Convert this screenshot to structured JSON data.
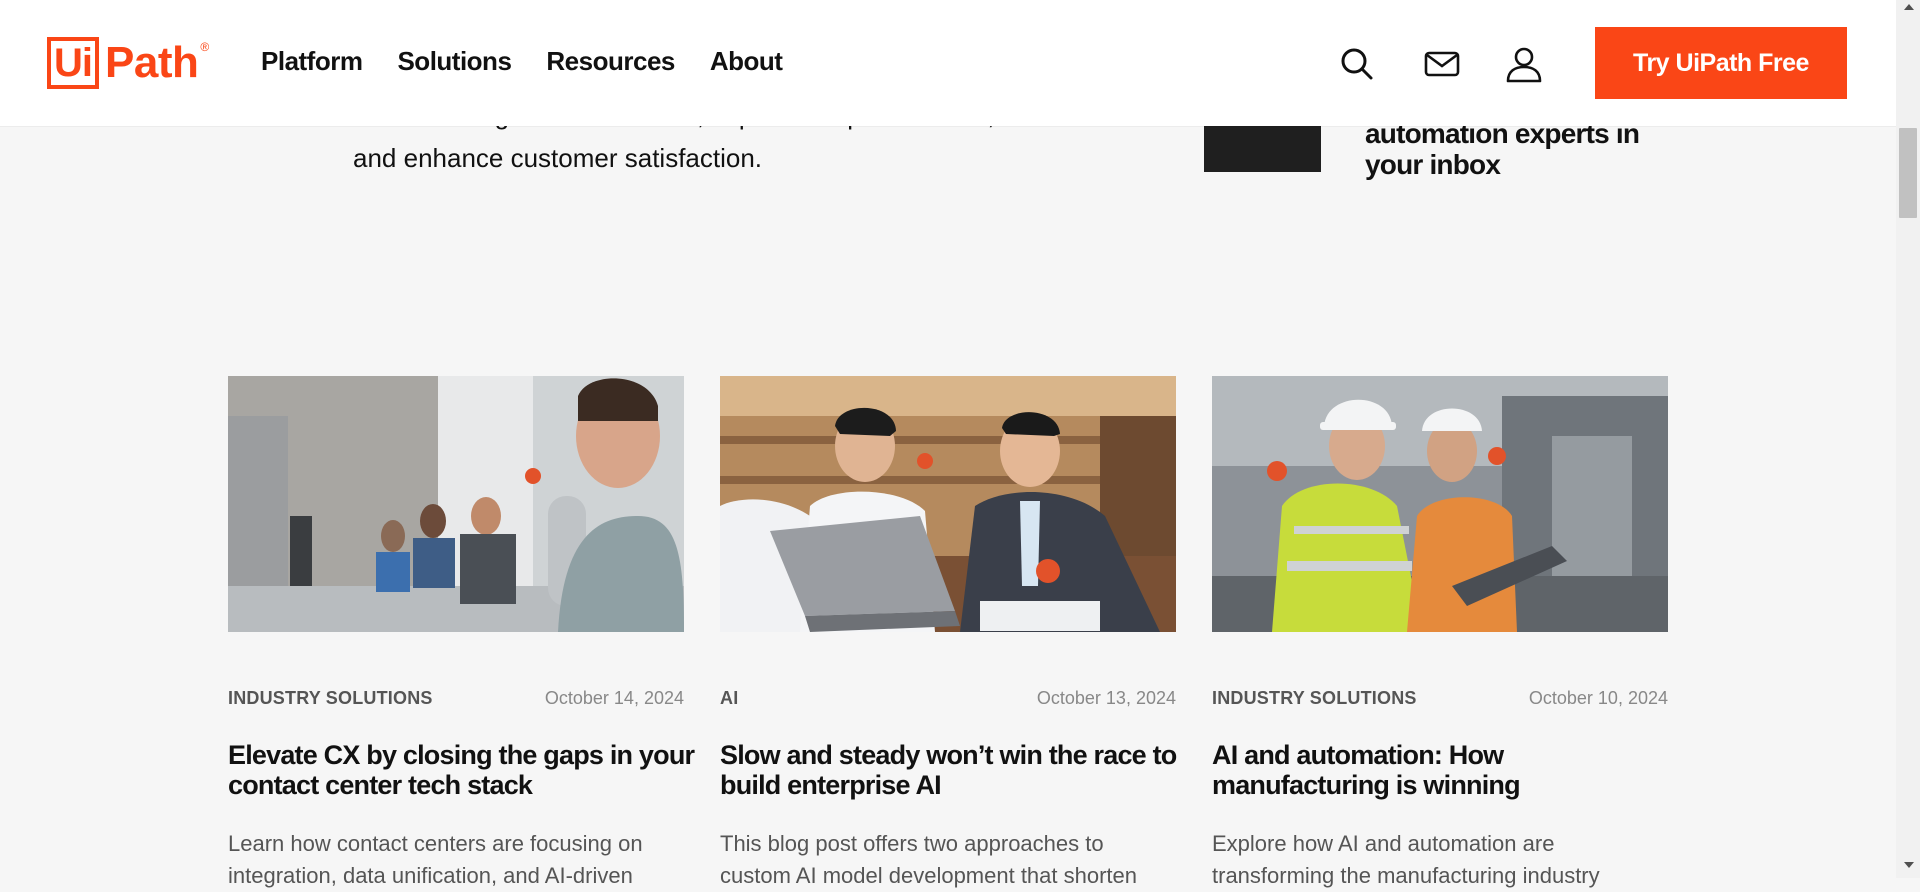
{
  "header": {
    "logo_box": "Ui",
    "logo_word": "Path",
    "logo_reg": "®",
    "nav": [
      "Platform",
      "Solutions",
      "Resources",
      "About"
    ],
    "cta": "Try UiPath Free",
    "icons": [
      "search-icon",
      "mail-icon",
      "user-icon"
    ]
  },
  "hero": {
    "partial_line": "banks manage email volumes, improve response times,",
    "last_line": "and enhance customer satisfaction.",
    "newsletter_line1": "automation experts in",
    "newsletter_line2": "your inbox"
  },
  "cards": [
    {
      "category": "INDUSTRY SOLUTIONS",
      "date": "October 14, 2024",
      "title": "Elevate CX by closing the gaps in your contact center tech stack",
      "description": "Learn how contact centers are focusing on integration, data unification, and AI-driven"
    },
    {
      "category": "AI",
      "date": "October 13, 2024",
      "title": "Slow and steady won’t win the race to build enterprise AI",
      "description": "This blog post offers two approaches to custom AI model development that shorten"
    },
    {
      "category": "INDUSTRY SOLUTIONS",
      "date": "October 10, 2024",
      "title": "AI and automation: How manufacturing is winning",
      "description": "Explore how AI and automation are transforming the manufacturing industry"
    }
  ],
  "colors": {
    "brand": "#fa4616",
    "background": "#f6f6f6",
    "text": "#111111"
  }
}
